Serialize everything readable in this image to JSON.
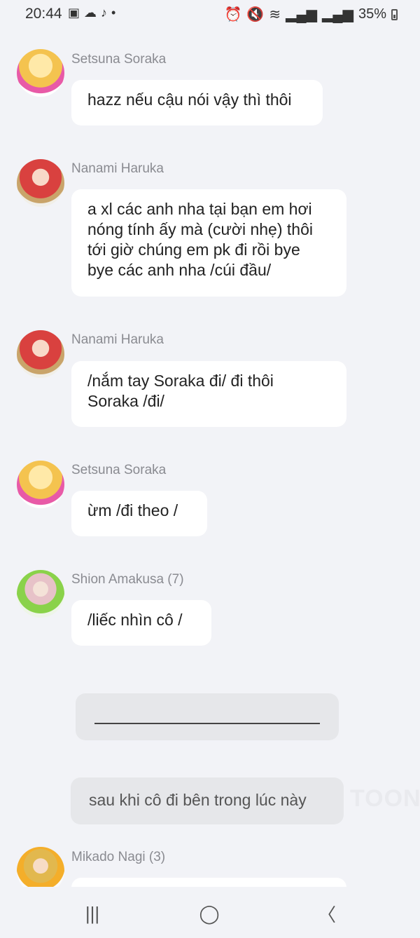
{
  "status_bar": {
    "time": "20:44",
    "battery": "35%",
    "left_icons": [
      "image-icon",
      "cloud-icon",
      "tiktok-icon",
      "dot-icon"
    ],
    "right_icons": [
      "alarm-icon",
      "mute-icon",
      "wifi-icon",
      "signal-icon",
      "signal-icon",
      "battery-icon"
    ]
  },
  "messages": [
    {
      "sender": "Setsuna Soraka",
      "avatar": "setsuna",
      "text": "hazz nếu cậu nói vậy thì thôi"
    },
    {
      "sender": "Nanami Haruka",
      "avatar": "nanami",
      "text": "a xl các anh nha tại bạn em hơi\nnóng tính ấy mà (cười nhẹ) thôi\ntới giờ chúng em pk đi rồi bye\nbye các anh nha /cúi đầu/"
    },
    {
      "sender": "Nanami Haruka",
      "avatar": "nanami",
      "text": "/nắm tay Soraka đi/ đi thôi\nSoraka /đi/"
    },
    {
      "sender": "Setsuna Soraka",
      "avatar": "setsuna",
      "text": "ừm /đi theo /"
    },
    {
      "sender": "Shion Amakusa (7)",
      "avatar": "shion",
      "text": "/liếc nhìn cô /"
    },
    {
      "sender": "Mikado Nagi (3)",
      "avatar": "mikado",
      "text": ""
    }
  ],
  "narration": {
    "text": "sau khi cô đi bên trong lúc này"
  },
  "watermark": "TOON",
  "nav": {
    "recent_glyph": "|||",
    "home_glyph": "◯",
    "back_glyph": "〈"
  }
}
